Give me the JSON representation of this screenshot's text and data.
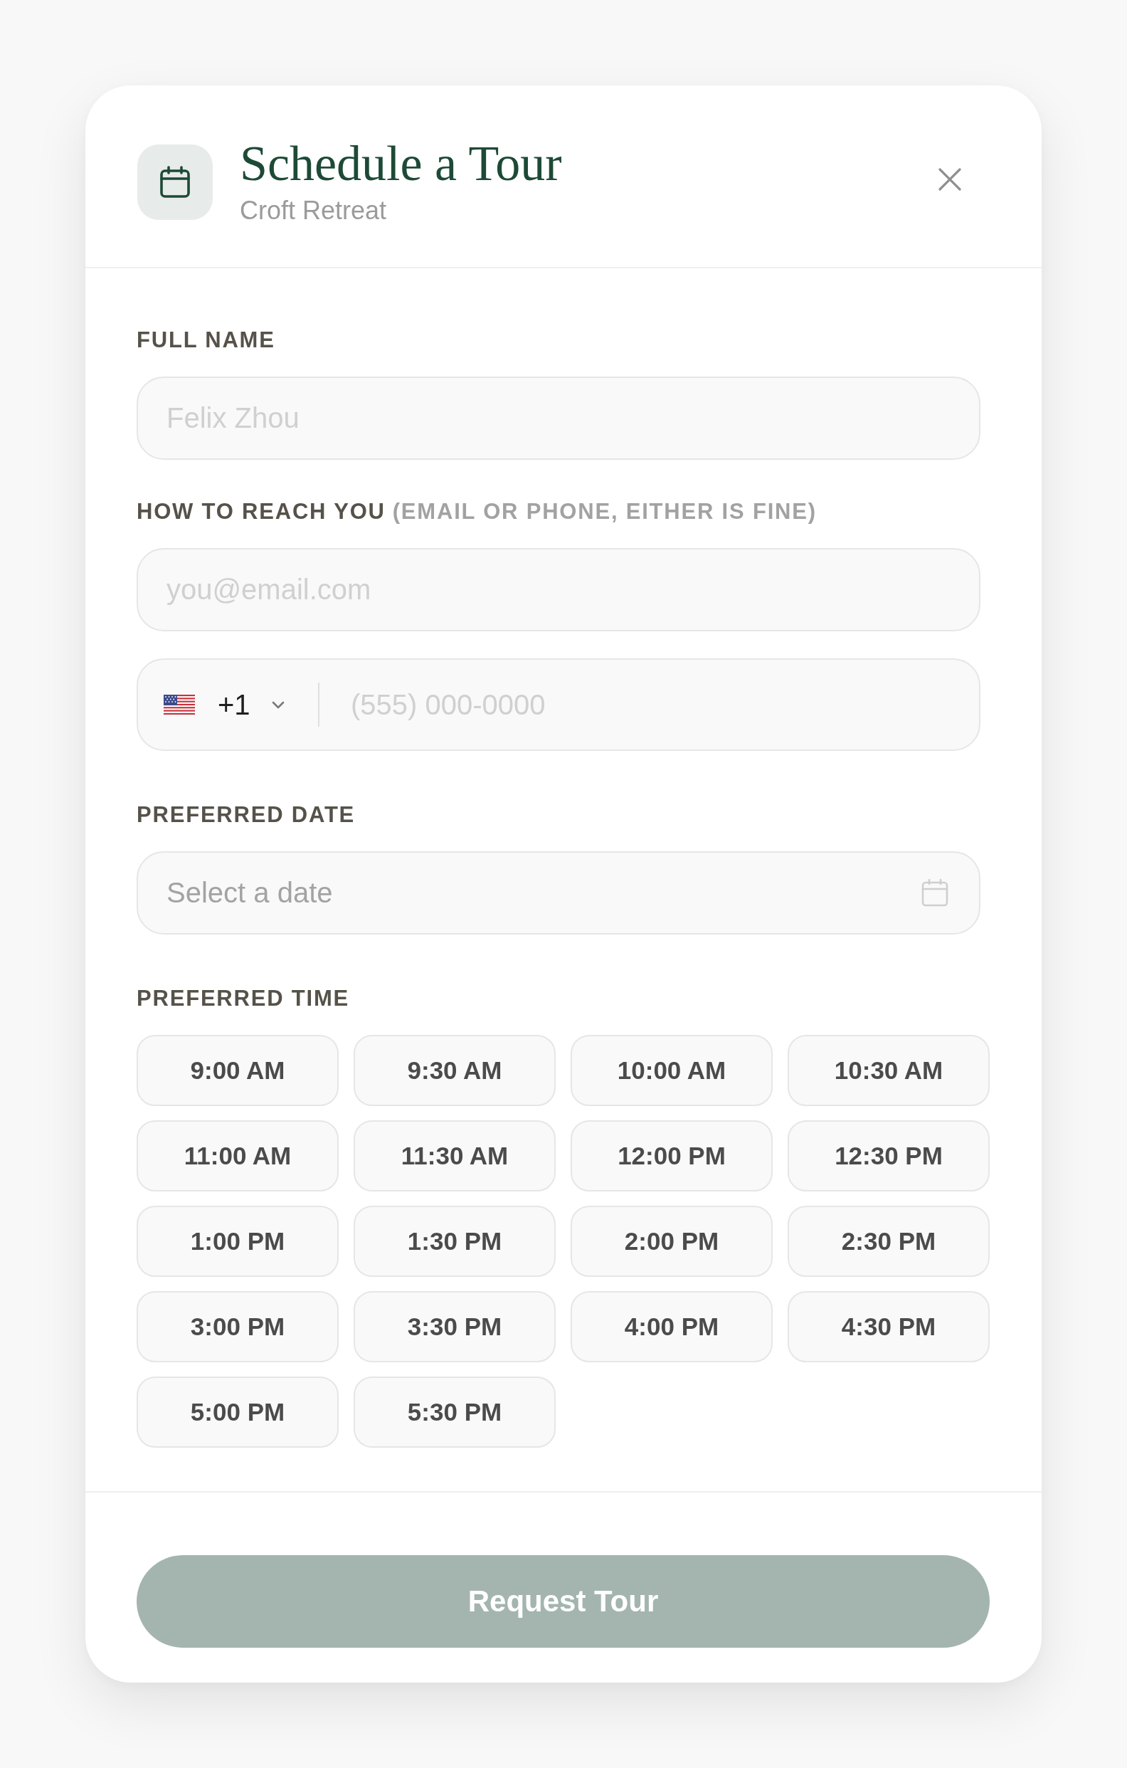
{
  "dialog": {
    "title": "Schedule a Tour",
    "subtitle": "Croft Retreat"
  },
  "full_name": {
    "label": "FULL NAME",
    "placeholder": "Felix Zhou"
  },
  "contact": {
    "label": "HOW TO REACH YOU",
    "hint": "(EMAIL OR PHONE, EITHER IS FINE)",
    "email": {
      "placeholder": "you@email.com"
    },
    "phone": {
      "country_code": "+1",
      "placeholder": "(555) 000-0000"
    }
  },
  "date": {
    "label": "PREFERRED DATE",
    "placeholder": "Select a date"
  },
  "time": {
    "label": "PREFERRED TIME",
    "slots": [
      {
        "label": "9:00 AM",
        "selected": false
      },
      {
        "label": "9:30 AM",
        "selected": false
      },
      {
        "label": "10:00 AM",
        "selected": false
      },
      {
        "label": "10:30 AM",
        "selected": false
      },
      {
        "label": "11:00 AM",
        "selected": false
      },
      {
        "label": "11:30 AM",
        "selected": false
      },
      {
        "label": "12:00 PM",
        "selected": false
      },
      {
        "label": "12:30 PM",
        "selected": false
      },
      {
        "label": "1:00 PM",
        "selected": false
      },
      {
        "label": "1:30 PM",
        "selected": false
      },
      {
        "label": "2:00 PM",
        "selected": false
      },
      {
        "label": "2:30 PM",
        "selected": false
      },
      {
        "label": "3:00 PM",
        "selected": false
      },
      {
        "label": "3:30 PM",
        "selected": false
      },
      {
        "label": "4:00 PM",
        "selected": false
      },
      {
        "label": "4:30 PM",
        "selected": false
      },
      {
        "label": "5:00 PM",
        "selected": false
      },
      {
        "label": "5:30 PM",
        "selected": false
      }
    ]
  },
  "submit": {
    "label": "Request Tour",
    "disabled": true
  }
}
